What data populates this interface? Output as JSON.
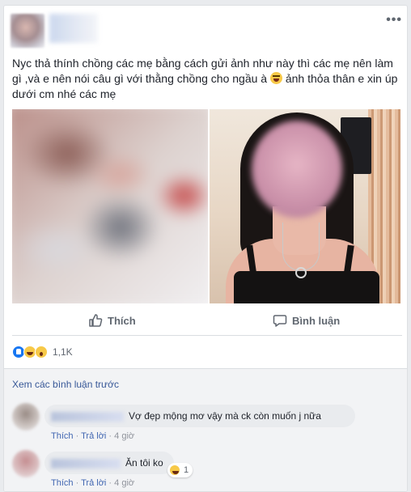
{
  "post": {
    "text_part1": "Nyc thả thính chồng các mẹ bằng cách gửi ảnh như này thì các mẹ nên làm gì ,và e nên nói câu gì với thằng chồng cho ngầu à ",
    "text_part2": " ảnh thỏa thân e xin úp dưới cm nhé các mẹ",
    "more_icon": "•••"
  },
  "actions": {
    "like_label": "Thích",
    "comment_label": "Bình luận"
  },
  "reactions": {
    "types": [
      "like",
      "haha",
      "wow"
    ],
    "count": "1,1K"
  },
  "comments_section": {
    "view_previous": "Xem các bình luận trước",
    "items": [
      {
        "text": "Vợ đẹp mộng mơ vậy mà ck còn muốn j nữa",
        "like": "Thích",
        "reply": "Trả lời",
        "time": "4 giờ"
      },
      {
        "text": "Ăn tôi ko",
        "like": "Thích",
        "reply": "Trả lời",
        "time": "4 giờ",
        "reaction_count": "1"
      }
    ]
  },
  "colors": {
    "link": "#385898",
    "action_text": "#606770",
    "like_blue": "#1877f2"
  }
}
